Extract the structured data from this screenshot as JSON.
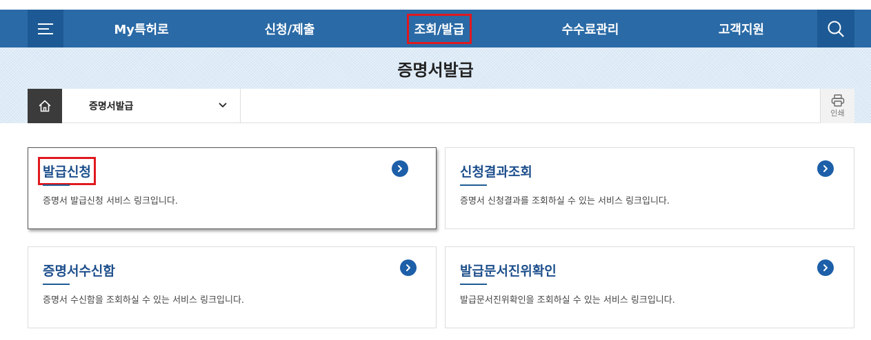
{
  "colors": {
    "nav_bg": "#2a6aa6",
    "nav_dark": "#1d5a95",
    "title_color": "#1d4f8c",
    "highlight_red": "#e0181e"
  },
  "nav": {
    "menu_icon": "hamburger-icon",
    "search_icon": "search-icon",
    "items": [
      {
        "label": "My특허로"
      },
      {
        "label": "신청/제출"
      },
      {
        "label": "조회/발급"
      },
      {
        "label": "수수료관리"
      },
      {
        "label": "고객지원"
      }
    ]
  },
  "header": {
    "page_title": "증명서발급"
  },
  "breadcrumb": {
    "home_icon": "home-icon",
    "selected": "증명서발급",
    "print_label": "인쇄",
    "print_icon": "printer-icon"
  },
  "cards": [
    {
      "title": "발급신청",
      "desc": "증명서 발급신청 서비스 링크입니다."
    },
    {
      "title": "신청결과조회",
      "desc": "증명서 신청결과를 조회하실 수 있는 서비스 링크입니다."
    },
    {
      "title": "증명서수신함",
      "desc": "증명서 수신함을 조회하실 수 있는 서비스 링크입니다."
    },
    {
      "title": "발급문서진위확인",
      "desc": "발급문서진위확인을 조회하실 수 있는 서비스 링크입니다."
    }
  ]
}
